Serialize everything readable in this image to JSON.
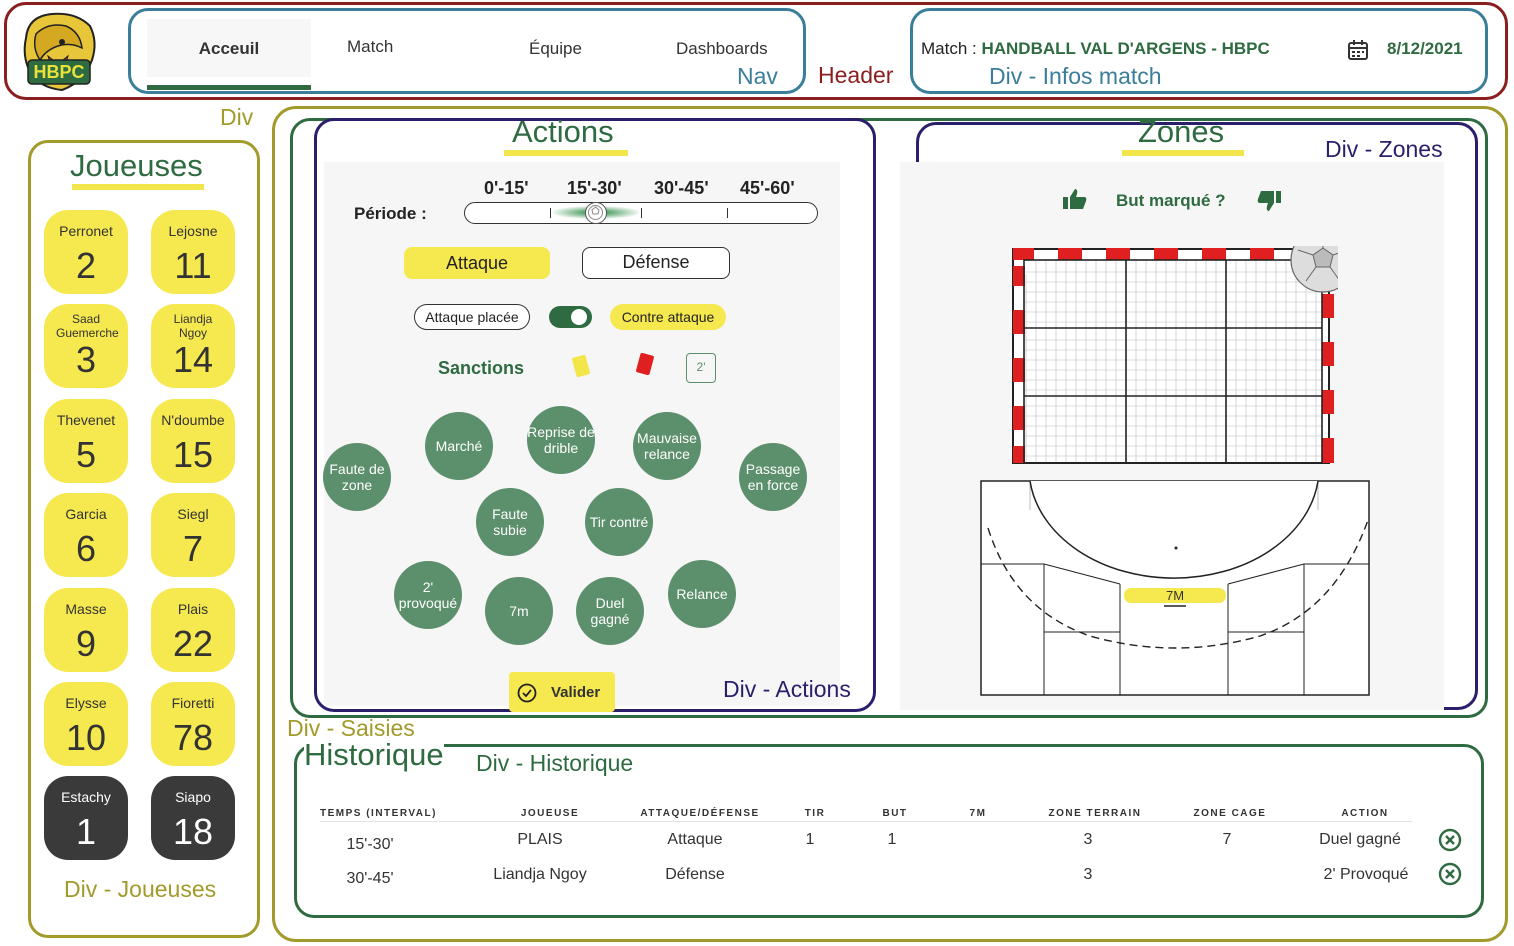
{
  "header": {
    "label": "Header",
    "nav_label": "Nav",
    "tabs": [
      "Acceuil",
      "Match",
      "Équipe",
      "Dashboards"
    ],
    "match_prefix": "Match : ",
    "match_name": "HANDBALL VAL D'ARGENS - HBPC",
    "date": "8/12/2021",
    "infos_label": "Div - Infos match",
    "logo_text": "HBPC"
  },
  "div_label": "Div",
  "joueuses": {
    "title": "Joueuses",
    "frame_label": "Div - Joueuses",
    "players": [
      {
        "name": "Perronet",
        "num": "2"
      },
      {
        "name": "Lejosne",
        "num": "11"
      },
      {
        "name": "Saad Guemerche",
        "num": "3"
      },
      {
        "name": "Liandja Ngoy",
        "num": "14"
      },
      {
        "name": "Thevenet",
        "num": "5"
      },
      {
        "name": "N'doumbe",
        "num": "15"
      },
      {
        "name": "Garcia",
        "num": "6"
      },
      {
        "name": "Siegl",
        "num": "7"
      },
      {
        "name": "Masse",
        "num": "9"
      },
      {
        "name": "Plais",
        "num": "22"
      },
      {
        "name": "Elysse",
        "num": "10"
      },
      {
        "name": "Fioretti",
        "num": "78"
      },
      {
        "name": "Estachy",
        "num": "1"
      },
      {
        "name": "Siapo",
        "num": "18"
      }
    ]
  },
  "actions": {
    "title": "Actions",
    "frame_label": "Div - Actions",
    "periode_label": "Période :",
    "periods": [
      "0'-15'",
      "15'-30'",
      "30'-45'",
      "45'-60'"
    ],
    "selected_period_index": 1,
    "attaque_label": "Attaque",
    "defense_label": "Défense",
    "attaque_placee": "Attaque placée",
    "contre_attaque": "Contre attaque",
    "sanctions_label": "Sanctions",
    "two_min_label": "2'",
    "buttons": [
      "Faute de zone",
      "Marché",
      "Reprise de drible",
      "Mauvaise relance",
      "Passage en force",
      "Faute subie",
      "Tir contré",
      "2' provoqué",
      "7m",
      "Duel gagné",
      "Relance"
    ],
    "valider": "Valider"
  },
  "zones": {
    "title": "Zones",
    "frame_label": "Div - Zones",
    "but_marque": "But marqué ?",
    "seven_m": "7M"
  },
  "saisies_label": "Div - Saisies",
  "historique": {
    "title": "Historique",
    "frame_label": "Div - Historique",
    "columns": [
      "TEMPS (INTERVAL)",
      "JOUEUSE",
      "ATTAQUE/DÉFENSE",
      "TIR",
      "BUT",
      "7M",
      "ZONE TERRAIN",
      "ZONE CAGE",
      "ACTION"
    ],
    "rows": [
      {
        "temps": "15'-30'",
        "joueuse": "PLAIS",
        "ad": "Attaque",
        "tir": "1",
        "but": "1",
        "sept": "",
        "zone_terrain": "3",
        "zone_cage": "7",
        "action": "Duel gagné"
      },
      {
        "temps": "30'-45'",
        "joueuse": "Liandja Ngoy",
        "ad": "Défense",
        "tir": "",
        "but": "",
        "sept": "",
        "zone_terrain": "3",
        "zone_cage": "",
        "action": "2' Provoqué"
      }
    ]
  },
  "colors": {
    "header_border": "#8b1f1f",
    "nav_border": "#3a7e9a",
    "olive": "#a29a2a",
    "green": "#2f6b41",
    "yellow": "#f6e94f",
    "purple": "#2a1f6b",
    "red_stripe": "#e02020"
  }
}
